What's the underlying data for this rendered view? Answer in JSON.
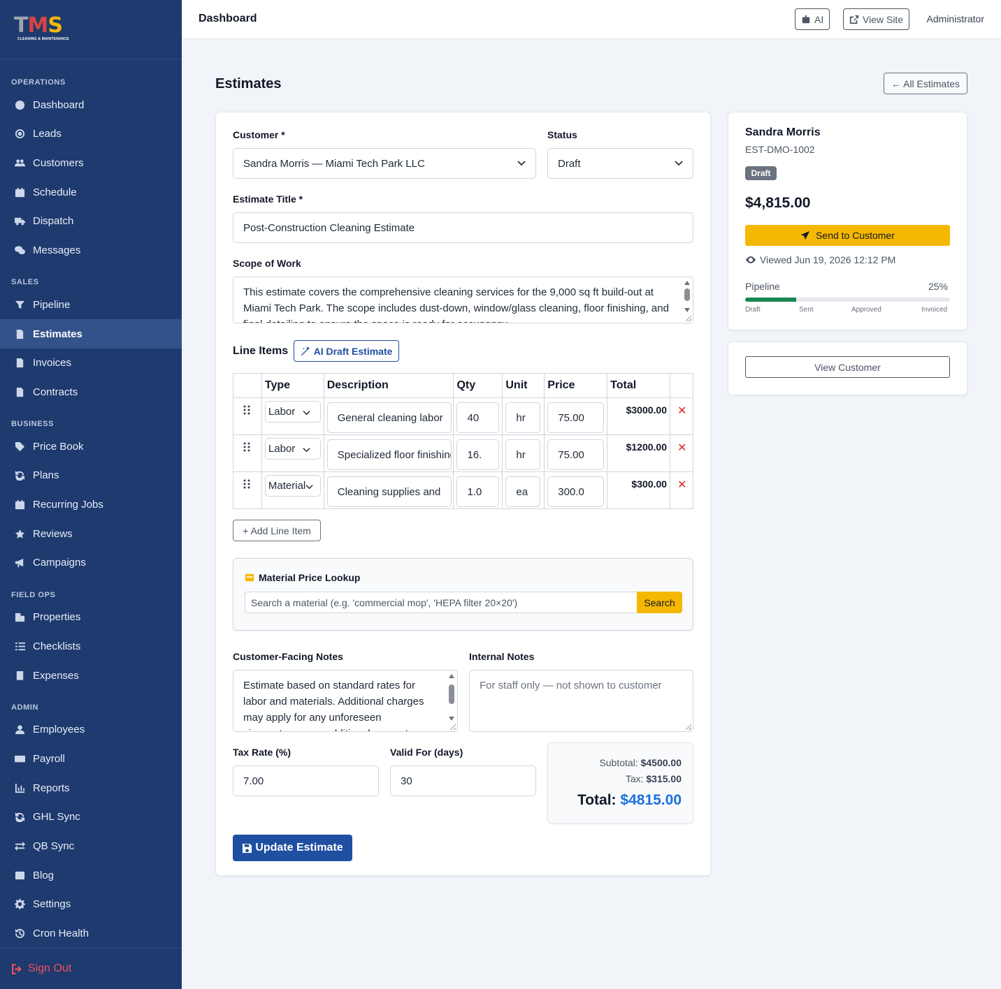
{
  "brand": {
    "letters": [
      "T",
      "M",
      "S"
    ],
    "tagline": "CLEANING & MAINTENANCE"
  },
  "sidebar": {
    "sections": [
      {
        "title": "OPERATIONS"
      },
      {
        "title": "SALES"
      },
      {
        "title": "BUSINESS"
      },
      {
        "title": "FIELD OPS"
      },
      {
        "title": "ADMIN"
      }
    ],
    "items": [
      {
        "label": "Dashboard",
        "icon": "dashboard-icon"
      },
      {
        "label": "Leads",
        "icon": "target-icon"
      },
      {
        "label": "Customers",
        "icon": "users-icon"
      },
      {
        "label": "Schedule",
        "icon": "calendar-icon"
      },
      {
        "label": "Dispatch",
        "icon": "truck-icon"
      },
      {
        "label": "Messages",
        "icon": "chat-icon"
      },
      {
        "label": "Pipeline",
        "icon": "filter-icon"
      },
      {
        "label": "Estimates",
        "icon": "document-icon",
        "active": true
      },
      {
        "label": "Invoices",
        "icon": "invoice-icon"
      },
      {
        "label": "Contracts",
        "icon": "contract-icon"
      },
      {
        "label": "Price Book",
        "icon": "tag-icon"
      },
      {
        "label": "Plans",
        "icon": "sync-icon"
      },
      {
        "label": "Recurring Jobs",
        "icon": "calendar-check-icon"
      },
      {
        "label": "Reviews",
        "icon": "star-icon"
      },
      {
        "label": "Campaigns",
        "icon": "megaphone-icon"
      },
      {
        "label": "Properties",
        "icon": "building-icon"
      },
      {
        "label": "Checklists",
        "icon": "list-check-icon"
      },
      {
        "label": "Expenses",
        "icon": "receipt-icon"
      },
      {
        "label": "Employees",
        "icon": "user-icon"
      },
      {
        "label": "Payroll",
        "icon": "money-icon"
      },
      {
        "label": "Reports",
        "icon": "chart-icon"
      },
      {
        "label": "GHL Sync",
        "icon": "sync-icon"
      },
      {
        "label": "QB Sync",
        "icon": "exchange-icon"
      },
      {
        "label": "Blog",
        "icon": "newspaper-icon"
      },
      {
        "label": "Settings",
        "icon": "gear-icon"
      },
      {
        "label": "Cron Health",
        "icon": "history-icon"
      }
    ],
    "signout": "Sign Out"
  },
  "topbar": {
    "title": "Dashboard",
    "ai_label": "AI",
    "view_site_label": "View Site",
    "user": "Administrator"
  },
  "page": {
    "title": "Estimates",
    "back_label": "← All Estimates"
  },
  "form": {
    "customer_label": "Customer *",
    "customer_value": "Sandra Morris — Miami Tech Park LLC",
    "status_label": "Status",
    "status_value": "Draft",
    "title_label": "Estimate Title *",
    "title_value": "Post-Construction Cleaning Estimate",
    "scope_label": "Scope of Work",
    "scope_value": "This estimate covers the comprehensive cleaning services for the 9,000 sq ft build-out at Miami Tech Park. The scope includes dust-down, window/glass cleaning, floor finishing, and final detailing to ensure the space is ready for occupancy.",
    "line_items_label": "Line Items",
    "ai_draft_label": "AI Draft Estimate",
    "columns": [
      "Type",
      "Description",
      "Qty",
      "Unit",
      "Price",
      "Total"
    ],
    "rows": [
      {
        "type": "Labor",
        "description": "General cleaning labor",
        "qty": "40",
        "unit": "hr",
        "price": "75.00",
        "total": "$3000.00"
      },
      {
        "type": "Labor",
        "description": "Specialized floor finishing",
        "qty": "16.",
        "unit": "hr",
        "price": "75.00",
        "total": "$1200.00"
      },
      {
        "type": "Material",
        "description": "Cleaning supplies and",
        "qty": "1.0",
        "unit": "ea",
        "price": "300.0",
        "total": "$300.00"
      }
    ],
    "add_line_label": "+ Add Line Item",
    "lookup_title": "Material Price Lookup",
    "lookup_placeholder": "Search a material (e.g. 'commercial mop', 'HEPA filter 20×20')",
    "lookup_button": "Search",
    "cust_notes_label": "Customer-Facing Notes",
    "cust_notes_value": "Estimate based on standard rates for labor and materials. Additional charges may apply for any unforeseen circumstances or additional requests.",
    "internal_notes_label": "Internal Notes",
    "internal_notes_placeholder": "For staff only — not shown to customer",
    "tax_label": "Tax Rate (%)",
    "tax_value": "7.00",
    "valid_label": "Valid For (days)",
    "valid_value": "30",
    "subtotal_label": "Subtotal:",
    "subtotal_value": "$4500.00",
    "tax_sum_label": "Tax:",
    "tax_sum_value": "$315.00",
    "total_label": "Total:",
    "total_value": "$4815.00",
    "update_label": "Update Estimate"
  },
  "summary": {
    "name": "Sandra Morris",
    "estimate_id": "EST-DMO-1002",
    "badge": "Draft",
    "amount": "$4,815.00",
    "send_label": "Send to Customer",
    "viewed": "Viewed Jun 19, 2026 12:12 PM",
    "pipeline_label": "Pipeline",
    "pipeline_pct_label": "25%",
    "pipeline_fraction": 0.25,
    "stages": [
      "Draft",
      "Sent",
      "Approved",
      "Invoiced"
    ],
    "view_customer_label": "View Customer"
  },
  "colors": {
    "sidebar": "#1e3a6e",
    "accent": "#f5b800",
    "primary": "#1e4fa0",
    "danger": "#dc2626",
    "success": "#198754"
  }
}
